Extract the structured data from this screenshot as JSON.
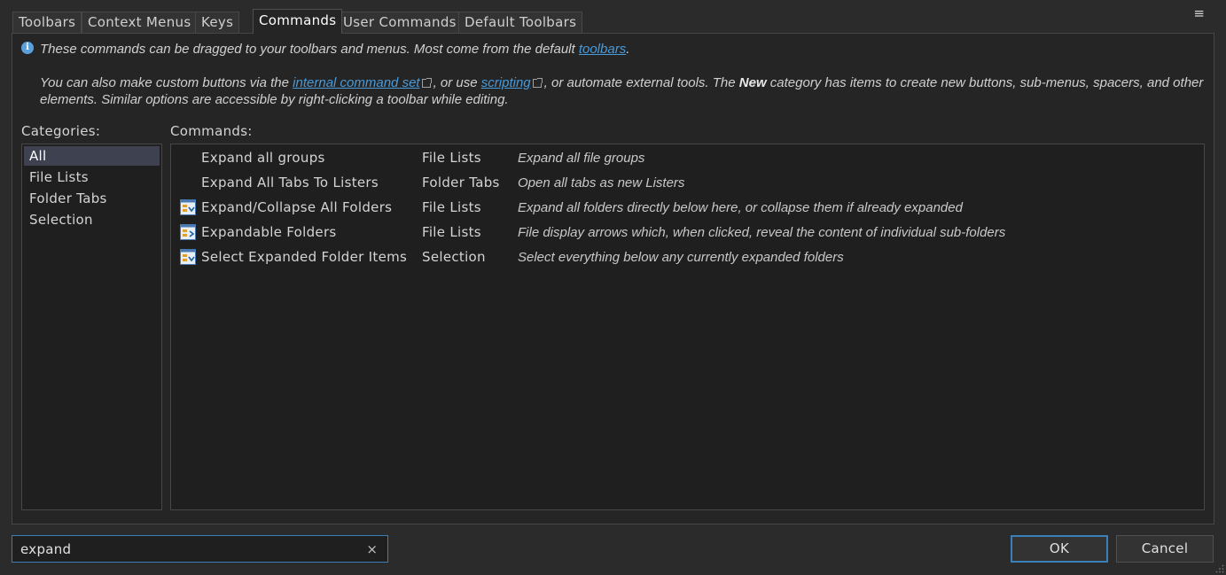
{
  "tabs": [
    "Toolbars",
    "Context Menus",
    "Keys",
    "Commands",
    "User Commands",
    "Default Toolbars"
  ],
  "active_tab": "Commands",
  "info": {
    "line1_text": "These commands can be dragged to your toolbars and menus. Most come from the default ",
    "line1_link": "toolbars",
    "line1_end": ".",
    "para_a": "You can also make custom buttons via the ",
    "link_internal": "internal command set",
    "para_b": ", or use ",
    "link_scripting": "scripting",
    "para_c": ", or automate external tools. The ",
    "para_bold": "New",
    "para_d": " category has items to create new buttons, sub-menus, spacers, and other elements. Similar options are accessible by right-clicking a toolbar while editing."
  },
  "categories_label": "Categories:",
  "commands_label": "Commands:",
  "categories": [
    "All",
    "File Lists",
    "Folder Tabs",
    "Selection"
  ],
  "selected_category": "All",
  "commands": [
    {
      "name": "Expand all groups",
      "category": "File Lists",
      "description": "Expand all file groups",
      "icon": "none"
    },
    {
      "name": "Expand All Tabs To Listers",
      "category": "Folder Tabs",
      "description": "Open all tabs as new Listers",
      "icon": "none"
    },
    {
      "name": "Expand/Collapse All Folders",
      "category": "File Lists",
      "description": "Expand all folders directly below here, or collapse them if already expanded",
      "icon": "folder-tree-icon"
    },
    {
      "name": "Expandable Folders",
      "category": "File Lists",
      "description": "File display arrows which, when clicked, reveal the content of individual sub-folders",
      "icon": "folder-tree-icon"
    },
    {
      "name": "Select Expanded Folder Items",
      "category": "Selection",
      "description": "Select everything below any currently expanded folders",
      "icon": "folder-tree-icon"
    }
  ],
  "search": {
    "value": "expand",
    "clear_glyph": "×"
  },
  "buttons": {
    "ok": "OK",
    "cancel": "Cancel"
  },
  "menu_glyph": "≡",
  "info_glyph": "i",
  "colors": {
    "accent": "#3a7fb8",
    "link": "#4a9ad8",
    "selection": "#3d4150"
  }
}
